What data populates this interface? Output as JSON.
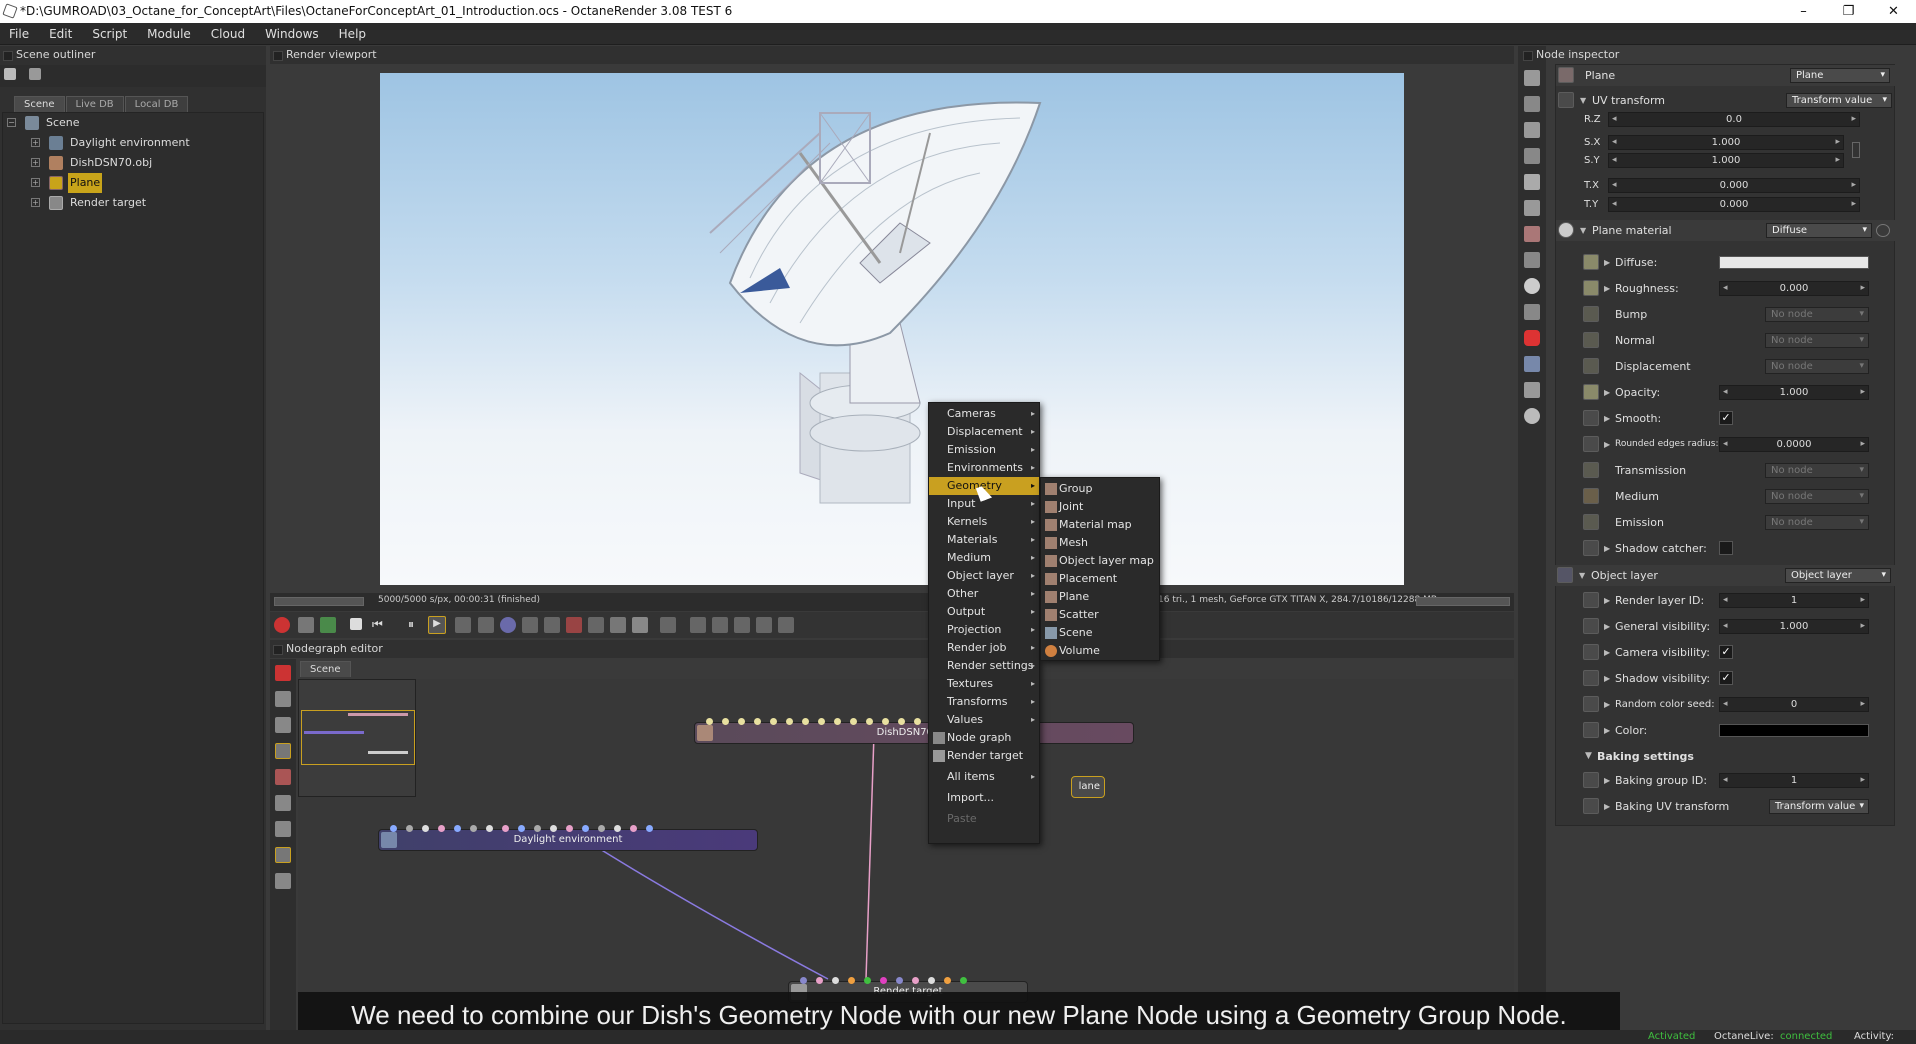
{
  "window": {
    "title": "*D:\\GUMROAD\\03_Octane_for_ConceptArt\\Files\\OctaneForConceptArt_01_Introduction.ocs - OctaneRender 3.08 TEST 6",
    "minimize": "–",
    "restore": "❐",
    "close": "✕"
  },
  "menubar": [
    "File",
    "Edit",
    "Script",
    "Module",
    "Cloud",
    "Windows",
    "Help"
  ],
  "outliner": {
    "title": "Scene outliner",
    "tabs": [
      "Scene",
      "Live DB",
      "Local DB"
    ],
    "items": [
      {
        "label": "Scene",
        "icon": "scene-icon"
      },
      {
        "label": "Daylight environment",
        "icon": "environment-icon"
      },
      {
        "label": "DishDSN70.obj",
        "icon": "mesh-icon"
      },
      {
        "label": "Plane",
        "icon": "mesh-icon"
      },
      {
        "label": "Render target",
        "icon": "render-target-icon"
      }
    ],
    "expand_glyph": "+",
    "collapse_glyph": "−"
  },
  "viewport": {
    "title": "Render viewport",
    "status_left": "5000/5000 s/px, 00:00:31 (finished)",
    "status_right": "16 tri., 1 mesh, GeForce GTX TITAN X, 284.7/10186/12288 MB"
  },
  "nodegraph": {
    "title": "Nodegraph editor",
    "tab": "Scene",
    "nodes": {
      "dish": "DishDSN70.obj",
      "daylight": "Daylight environment",
      "render_target": "Render target",
      "plane": "lane"
    }
  },
  "context_menu": {
    "items": [
      "Cameras",
      "Displacement",
      "Emission",
      "Environments",
      "Geometry",
      "Input",
      "Kernels",
      "Materials",
      "Medium",
      "Object layer",
      "Other",
      "Output",
      "Projection",
      "Render job",
      "Render settings",
      "Textures",
      "Transforms",
      "Values"
    ],
    "extra": [
      "Node graph",
      "Render target"
    ],
    "all_items": "All items",
    "import": "Import...",
    "paste": "Paste",
    "highlighted": "Geometry"
  },
  "submenu": {
    "items": [
      "Group",
      "Joint",
      "Material map",
      "Mesh",
      "Object layer map",
      "Placement",
      "Plane",
      "Scatter",
      "Scene",
      "Volume"
    ]
  },
  "inspector": {
    "title": "Node inspector",
    "node_name": "Plane",
    "node_type": "Plane",
    "uv_transform": {
      "label": "UV transform",
      "mode": "Transform value",
      "rz_label": "R.Z",
      "rz": "0.0",
      "sx_label": "S.X",
      "sx": "1.000",
      "sy_label": "S.Y",
      "sy": "1.000",
      "tx_label": "T.X",
      "tx": "0.000",
      "ty_label": "T.Y",
      "ty": "0.000"
    },
    "material": {
      "label": "Plane material",
      "type": "Diffuse"
    },
    "rows": {
      "diffuse": "Diffuse:",
      "roughness": "Roughness:",
      "roughness_val": "0.000",
      "bump": "Bump",
      "normal": "Normal",
      "displacement": "Displacement",
      "opacity": "Opacity:",
      "opacity_val": "1.000",
      "smooth": "Smooth:",
      "rounded": "Rounded edges radius:",
      "rounded_val": "0.0000",
      "transmission": "Transmission",
      "medium": "Medium",
      "emission": "Emission",
      "shadow_catcher": "Shadow catcher:",
      "no_node": "No node"
    },
    "object_layer": {
      "label": "Object layer",
      "type": "Object layer",
      "render_layer_id": "Render layer ID:",
      "render_layer_id_val": "1",
      "general_visibility": "General visibility:",
      "general_visibility_val": "1.000",
      "camera_visibility": "Camera visibility:",
      "shadow_visibility": "Shadow visibility:",
      "random_color_seed": "Random color seed:",
      "random_color_seed_val": "0",
      "color": "Color:"
    },
    "baking": {
      "label": "Baking settings",
      "group_id": "Baking group ID:",
      "group_id_val": "1",
      "uv_transform": "Baking UV transform",
      "uv_mode": "Transform value"
    },
    "check_glyph": "✓"
  },
  "subtitle": "We need to combine our Dish's Geometry Node with our new Plane Node using a Geometry Group Node.",
  "statusbar": {
    "activated": "Activated",
    "octanelive_label": "OctaneLive:",
    "octanelive_status": "connected",
    "activity": "Activity:"
  },
  "colors": {
    "accent": "#c9a020",
    "connected": "#3fbf3f",
    "highlight": "#c8a41a"
  }
}
